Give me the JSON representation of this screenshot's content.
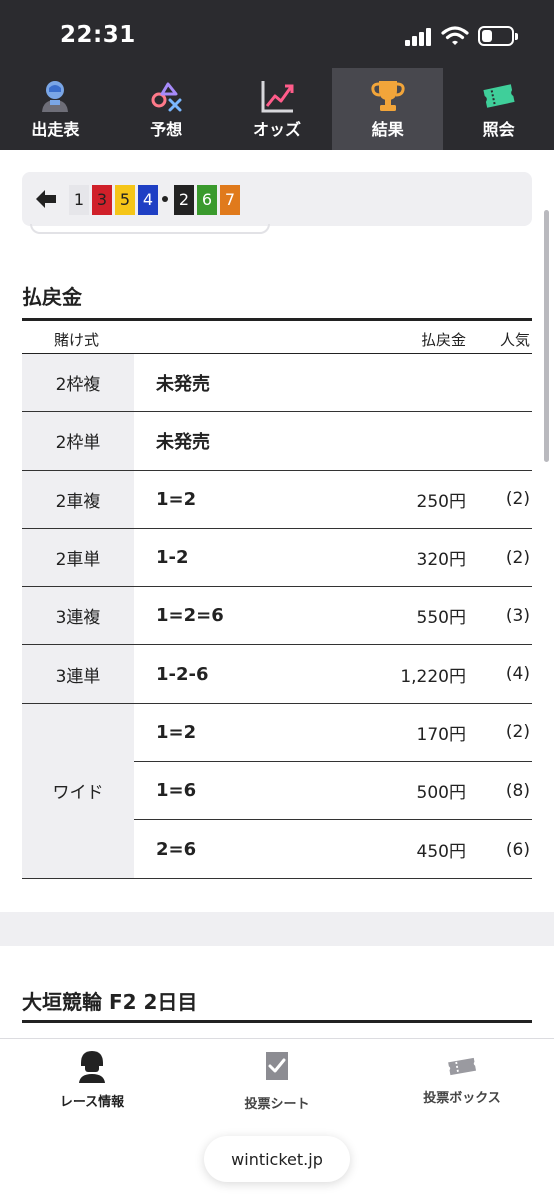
{
  "status_bar": {
    "time": "22:31"
  },
  "top_tabs": [
    {
      "label": "出走表",
      "icon": "player-icon",
      "active": false
    },
    {
      "label": "予想",
      "icon": "shapes-icon",
      "active": false
    },
    {
      "label": "オッズ",
      "icon": "chart-icon",
      "active": false
    },
    {
      "label": "結果",
      "icon": "trophy-icon",
      "active": true
    },
    {
      "label": "照会",
      "icon": "ticket-icon",
      "active": false
    }
  ],
  "race_header": {
    "lineup": [
      {
        "num": "1",
        "bg": "#e6e6ea",
        "fg": "#222222"
      },
      {
        "num": "3",
        "bg": "#d0202a",
        "fg": "#222222"
      },
      {
        "num": "5",
        "bg": "#f5c518",
        "fg": "#222222"
      },
      {
        "num": "4",
        "bg": "#1f3fc4",
        "fg": "#ffffff"
      },
      {
        "num": "2",
        "bg": "#222222",
        "fg": "#ffffff"
      },
      {
        "num": "6",
        "bg": "#3a9a2d",
        "fg": "#ffffff"
      },
      {
        "num": "7",
        "bg": "#e07a1c",
        "fg": "#ffffff"
      }
    ]
  },
  "payout": {
    "title": "払戻金",
    "headers": {
      "bet_type": "賭け式",
      "amount": "払戻金",
      "popularity": "人気"
    },
    "rows": [
      {
        "type": "2枠複",
        "combo": "未発売",
        "amount": "",
        "popularity": ""
      },
      {
        "type": "2枠単",
        "combo": "未発売",
        "amount": "",
        "popularity": ""
      },
      {
        "type": "2車複",
        "combo": "1=2",
        "amount": "250円",
        "popularity": "(2)"
      },
      {
        "type": "2車単",
        "combo": "1-2",
        "amount": "320円",
        "popularity": "(2)"
      },
      {
        "type": "3連複",
        "combo": "1=2=6",
        "amount": "550円",
        "popularity": "(3)"
      },
      {
        "type": "3連単",
        "combo": "1-2-6",
        "amount": "1,220円",
        "popularity": "(4)"
      }
    ],
    "wide": {
      "type": "ワイド",
      "entries": [
        {
          "combo": "1=2",
          "amount": "170円",
          "popularity": "(2)"
        },
        {
          "combo": "1=6",
          "amount": "500円",
          "popularity": "(8)"
        },
        {
          "combo": "2=6",
          "amount": "450円",
          "popularity": "(6)"
        }
      ]
    }
  },
  "venue": {
    "title": "大垣競輪 F2 2日目"
  },
  "bottom_nav": [
    {
      "label": "レース情報",
      "icon": "helmet-icon",
      "active": true
    },
    {
      "label": "投票シート",
      "icon": "check-sheet-icon",
      "active": false
    },
    {
      "label": "投票ボックス",
      "icon": "tickets-box-icon",
      "active": false
    }
  ],
  "url": "winticket.jp",
  "colors": {
    "header_bg": "#2b2b2f",
    "active_tab_bg": "#48484e",
    "panel_grey": "#efeff2"
  }
}
